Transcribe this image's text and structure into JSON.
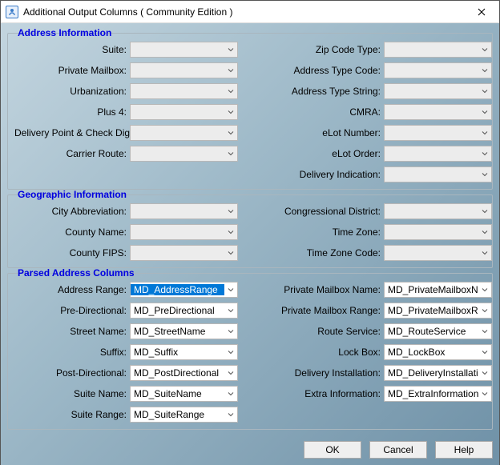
{
  "window": {
    "title": "Additional Output Columns ( Community Edition )"
  },
  "groups": {
    "address_info": {
      "title": "Address Information",
      "left": [
        {
          "label": "Suite:",
          "value": ""
        },
        {
          "label": "Private Mailbox:",
          "value": ""
        },
        {
          "label": "Urbanization:",
          "value": ""
        },
        {
          "label": "Plus 4:",
          "value": ""
        },
        {
          "label": "Delivery Point & Check Digit:",
          "value": ""
        },
        {
          "label": "Carrier Route:",
          "value": ""
        }
      ],
      "right": [
        {
          "label": "Zip Code Type:",
          "value": ""
        },
        {
          "label": "Address Type Code:",
          "value": ""
        },
        {
          "label": "Address Type String:",
          "value": ""
        },
        {
          "label": "CMRA:",
          "value": ""
        },
        {
          "label": "eLot Number:",
          "value": ""
        },
        {
          "label": "eLot Order:",
          "value": ""
        },
        {
          "label": "Delivery Indication:",
          "value": ""
        }
      ]
    },
    "geo_info": {
      "title": "Geographic Information",
      "left": [
        {
          "label": "City Abbreviation:",
          "value": ""
        },
        {
          "label": "County Name:",
          "value": ""
        },
        {
          "label": "County FIPS:",
          "value": ""
        }
      ],
      "right": [
        {
          "label": "Congressional District:",
          "value": ""
        },
        {
          "label": "Time Zone:",
          "value": ""
        },
        {
          "label": "Time Zone Code:",
          "value": ""
        }
      ]
    },
    "parsed": {
      "title": "Parsed Address Columns",
      "left": [
        {
          "label": "Address Range:",
          "value": "MD_AddressRange",
          "selected": true
        },
        {
          "label": "Pre-Directional:",
          "value": "MD_PreDirectional"
        },
        {
          "label": "Street Name:",
          "value": "MD_StreetName"
        },
        {
          "label": "Suffix:",
          "value": "MD_Suffix"
        },
        {
          "label": "Post-Directional:",
          "value": "MD_PostDirectional"
        },
        {
          "label": "Suite Name:",
          "value": "MD_SuiteName"
        },
        {
          "label": "Suite Range:",
          "value": "MD_SuiteRange"
        }
      ],
      "right": [
        {
          "label": "Private Mailbox Name:",
          "value": "MD_PrivateMailboxName"
        },
        {
          "label": "Private Mailbox Range:",
          "value": "MD_PrivateMailboxRange"
        },
        {
          "label": "Route Service:",
          "value": "MD_RouteService"
        },
        {
          "label": "Lock Box:",
          "value": "MD_LockBox"
        },
        {
          "label": "Delivery Installation:",
          "value": "MD_DeliveryInstallation"
        },
        {
          "label": "Extra Information:",
          "value": "MD_ExtraInformation"
        }
      ]
    }
  },
  "buttons": {
    "ok": "OK",
    "cancel": "Cancel",
    "help": "Help"
  }
}
